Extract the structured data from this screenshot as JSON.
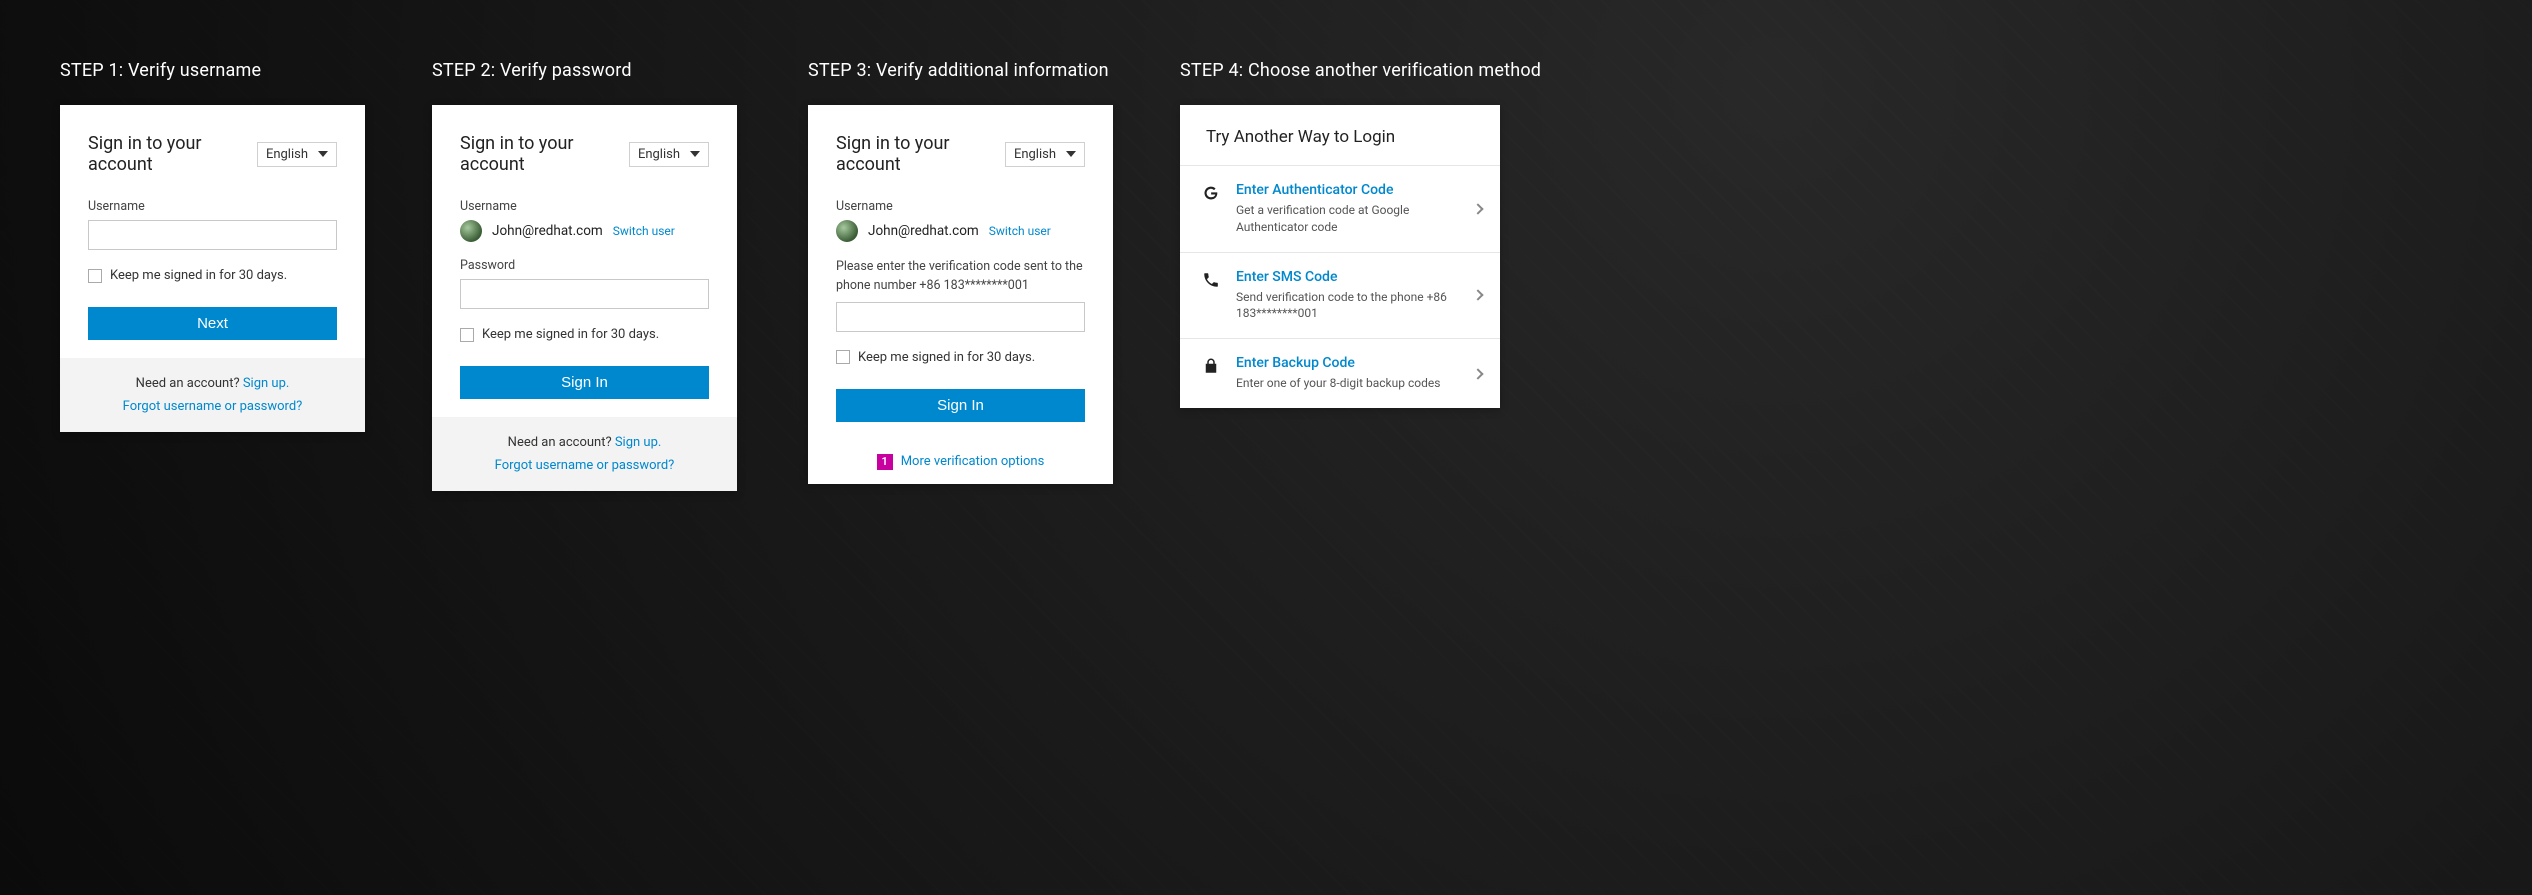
{
  "steps": {
    "s1": {
      "label": "STEP 1: Verify username"
    },
    "s2": {
      "label": "STEP 2: Verify password"
    },
    "s3": {
      "label": "STEP 3: Verify additional information"
    },
    "s4": {
      "label": "STEP 4: Choose another verification method"
    }
  },
  "common": {
    "signin_title": "Sign in to your account",
    "language": "English",
    "keep_signed": "Keep me signed in for 30 days.",
    "need_account": "Need an account? ",
    "signup": "Sign up.",
    "forgot": "Forgot username or password?",
    "switch_user": "Switch user"
  },
  "step1": {
    "username_label": "Username",
    "next_btn": "Next"
  },
  "step2": {
    "username_label": "Username",
    "user_email": "John@redhat.com",
    "password_label": "Password",
    "signin_btn": "Sign In"
  },
  "step3": {
    "username_label": "Username",
    "user_email": "John@redhat.com",
    "help_text": "Please enter the verification code sent to the phone number +86 183********001",
    "signin_btn": "Sign In",
    "badge": "1",
    "more_opts": "More verification options"
  },
  "step4": {
    "title": "Try Another Way to Login",
    "methods": [
      {
        "label": "Enter Authenticator Code",
        "desc": "Get a verification code at Google Authenticator code"
      },
      {
        "label": "Enter SMS Code",
        "desc": "Send verification code to the phone +86 183********001"
      },
      {
        "label": "Enter Backup Code",
        "desc": "Enter one of your 8-digit backup codes"
      }
    ]
  }
}
